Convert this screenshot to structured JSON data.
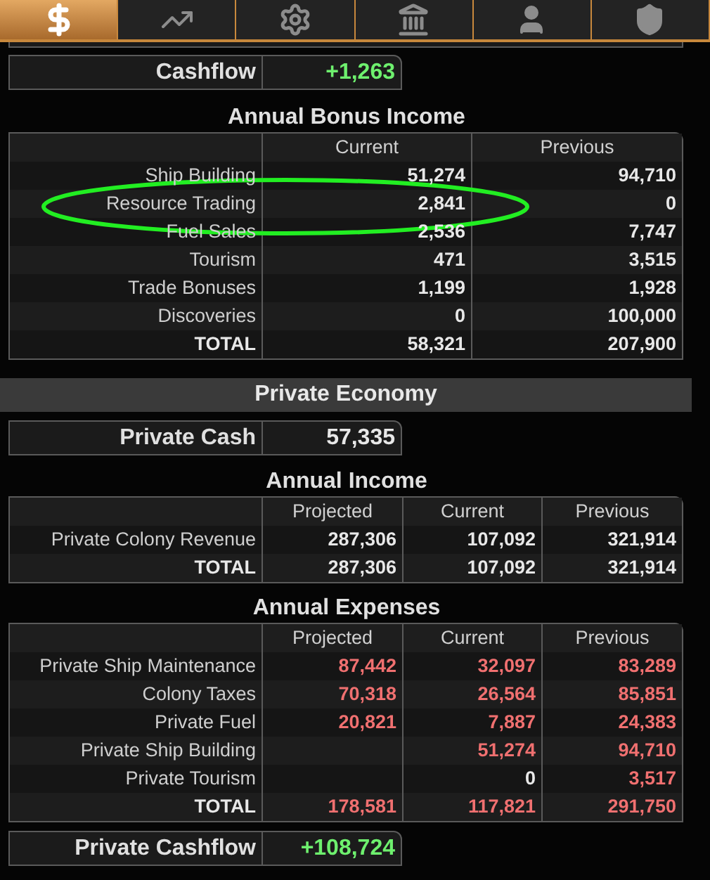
{
  "tabs": [
    {
      "kind": "dollar",
      "selected": true
    },
    {
      "kind": "chart",
      "selected": false
    },
    {
      "kind": "gear",
      "selected": false
    },
    {
      "kind": "bank",
      "selected": false
    },
    {
      "kind": "person",
      "selected": false
    },
    {
      "kind": "shield",
      "selected": false
    }
  ],
  "cashflow": {
    "label": "Cashflow",
    "value": "+1,263",
    "kind": "positive"
  },
  "bonus_income": {
    "title": "Annual Bonus Income",
    "columns": [
      "Current",
      "Previous"
    ],
    "kind": "plain",
    "rows": [
      {
        "label": "Ship Building",
        "cells": [
          "51,274",
          "94,710"
        ],
        "bold": false
      },
      {
        "label": "Resource Trading",
        "cells": [
          "2,841",
          "0"
        ],
        "bold": false,
        "circled": true
      },
      {
        "label": "Fuel Sales",
        "cells": [
          "2,536",
          "7,747"
        ],
        "bold": false
      },
      {
        "label": "Tourism",
        "cells": [
          "471",
          "3,515"
        ],
        "bold": false
      },
      {
        "label": "Trade Bonuses",
        "cells": [
          "1,199",
          "1,928"
        ],
        "bold": false
      },
      {
        "label": "Discoveries",
        "cells": [
          "0",
          "100,000"
        ],
        "bold": false
      },
      {
        "label": "TOTAL",
        "cells": [
          "58,321",
          "207,900"
        ],
        "bold": true
      }
    ]
  },
  "private_economy": {
    "title": "Private Economy",
    "cash": {
      "label": "Private Cash",
      "value": "57,335",
      "kind": "plain"
    },
    "income": {
      "title": "Annual Income",
      "columns": [
        "Projected",
        "Current",
        "Previous"
      ],
      "kind": "plain",
      "rows": [
        {
          "label": "Private Colony Revenue",
          "cells": [
            "287,306",
            "107,092",
            "321,914"
          ],
          "bold": false
        },
        {
          "label": "TOTAL",
          "cells": [
            "287,306",
            "107,092",
            "321,914"
          ],
          "bold": true
        }
      ]
    },
    "expenses": {
      "title": "Annual Expenses",
      "columns": [
        "Projected",
        "Current",
        "Previous"
      ],
      "kind": "negative",
      "rows": [
        {
          "label": "Private Ship Maintenance",
          "cells": [
            "87,442",
            "32,097",
            "83,289"
          ],
          "bold": false
        },
        {
          "label": "Colony Taxes",
          "cells": [
            "70,318",
            "26,564",
            "85,851"
          ],
          "bold": false
        },
        {
          "label": "Private Fuel",
          "cells": [
            "20,821",
            "7,887",
            "24,383"
          ],
          "bold": false
        },
        {
          "label": "Private Ship Building",
          "cells": [
            null,
            "51,274",
            "94,710"
          ],
          "bold": false
        },
        {
          "label": "Private Tourism",
          "cells": [
            null,
            {
              "text": "0",
              "kind": "plain"
            },
            "3,517"
          ],
          "bold": false
        },
        {
          "label": "TOTAL",
          "cells": [
            "178,581",
            "117,821",
            "291,750"
          ],
          "bold": true
        }
      ]
    },
    "cashflow": {
      "label": "Private Cashflow",
      "value": "+108,724",
      "kind": "positive"
    }
  }
}
